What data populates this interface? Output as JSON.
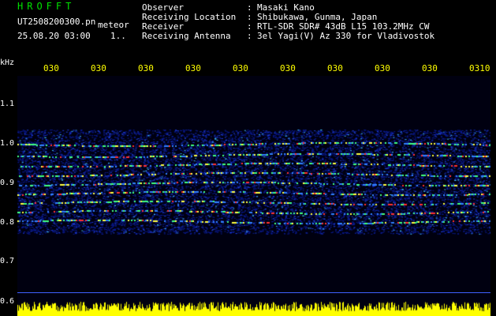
{
  "header": {
    "brand": "HROFFT",
    "filename": "UT2508200300.pn",
    "mode": "meteor",
    "datetime": "25.08.20 03:00",
    "page": "1.."
  },
  "info": [
    {
      "label": "Observer",
      "value": "Masaki Kano"
    },
    {
      "label": "Receiving Location",
      "value": "Shibukawa, Gunma, Japan"
    },
    {
      "label": "Receiver",
      "value": "RTL-SDR SDR# 43dB L15 103.2MHz CW"
    },
    {
      "label": "Receiving Antenna",
      "value": "3el Yagi(V) Az 330 for Vladivostok"
    }
  ],
  "info_separator": ":",
  "axis": {
    "y_unit": "kHz",
    "y_ticks": [
      "1.1",
      "1.0",
      "0.9",
      "0.8",
      "0.7",
      "0.6"
    ],
    "x_ticks": [
      "030",
      "030",
      "030",
      "030",
      "030",
      "030",
      "030",
      "030",
      "030",
      "0310"
    ]
  },
  "colors": {
    "background": "#000000",
    "header_green": "#00e000",
    "tick_yellow": "#ffff00",
    "signal_bar": "#ffff00"
  }
}
